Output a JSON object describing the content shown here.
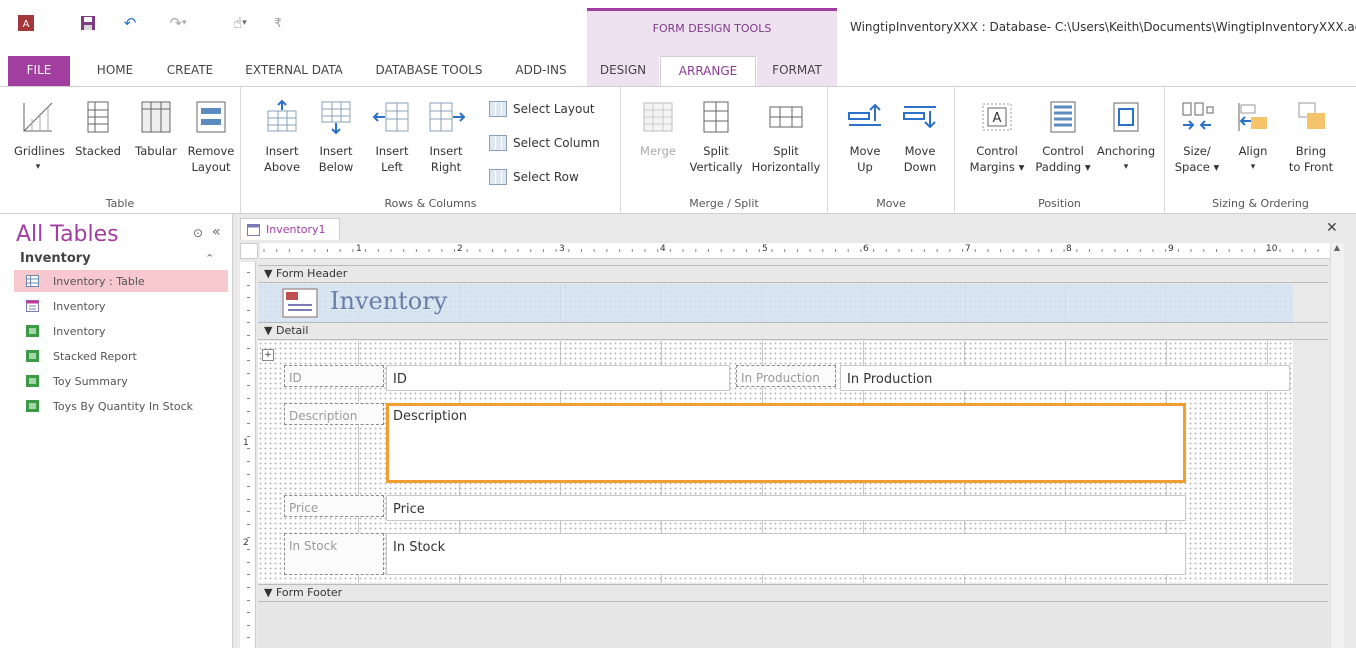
{
  "window": {
    "title": "WingtipInventoryXXX : Database- C:\\Users\\Keith\\Documents\\WingtipInventoryXXX.accdb",
    "context_tools_title": "FORM DESIGN TOOLS"
  },
  "tabs": {
    "file": "FILE",
    "home": "HOME",
    "create": "CREATE",
    "external": "EXTERNAL DATA",
    "dbtools": "DATABASE TOOLS",
    "addins": "ADD-INS",
    "design": "DESIGN",
    "arrange": "ARRANGE",
    "format": "FORMAT"
  },
  "ribbon": {
    "table": {
      "label": "Table",
      "gridlines": "Gridlines",
      "stacked": "Stacked",
      "tabular": "Tabular",
      "remove_layout_1": "Remove",
      "remove_layout_2": "Layout"
    },
    "rows_cols": {
      "label": "Rows & Columns",
      "insert_above_1": "Insert",
      "insert_above_2": "Above",
      "insert_below_1": "Insert",
      "insert_below_2": "Below",
      "insert_left_1": "Insert",
      "insert_left_2": "Left",
      "insert_right_1": "Insert",
      "insert_right_2": "Right",
      "select_layout": "Select Layout",
      "select_column": "Select Column",
      "select_row": "Select Row"
    },
    "merge_split": {
      "label": "Merge / Split",
      "merge": "Merge",
      "split_v_1": "Split",
      "split_v_2": "Vertically",
      "split_h_1": "Split",
      "split_h_2": "Horizontally"
    },
    "move": {
      "label": "Move",
      "up_1": "Move",
      "up_2": "Up",
      "down_1": "Move",
      "down_2": "Down"
    },
    "position": {
      "label": "Position",
      "margins_1": "Control",
      "margins_2": "Margins ▾",
      "padding_1": "Control",
      "padding_2": "Padding ▾",
      "anchoring": "Anchoring"
    },
    "sizing": {
      "label": "Sizing & Ordering",
      "size_1": "Size/",
      "size_2": "Space ▾",
      "align": "Align",
      "bring_1": "Bring",
      "bring_2": "to Front"
    }
  },
  "nav": {
    "title": "All Tables",
    "group": "Inventory",
    "items": [
      {
        "label": "Inventory : Table"
      },
      {
        "label": "Inventory"
      },
      {
        "label": "Inventory"
      },
      {
        "label": "Stacked Report"
      },
      {
        "label": "Toy Summary"
      },
      {
        "label": "Toys By Quantity In Stock"
      }
    ]
  },
  "document": {
    "tab": "Inventory1",
    "form_header": "Form Header",
    "detail": "Detail",
    "form_footer": "Form Footer",
    "header_title": "Inventory",
    "ruler": [
      "1",
      "2",
      "3",
      "4",
      "5",
      "6",
      "7",
      "8",
      "9",
      "10"
    ],
    "vruler": [
      "1",
      "2"
    ],
    "fields": {
      "id_label": "ID",
      "id_value": "ID",
      "inprod_label": "In Production",
      "inprod_value": "In Production",
      "desc_label": "Description",
      "desc_value": "Description",
      "price_label": "Price",
      "price_value": "Price",
      "stock_label": "In Stock",
      "stock_value": "In Stock"
    }
  }
}
